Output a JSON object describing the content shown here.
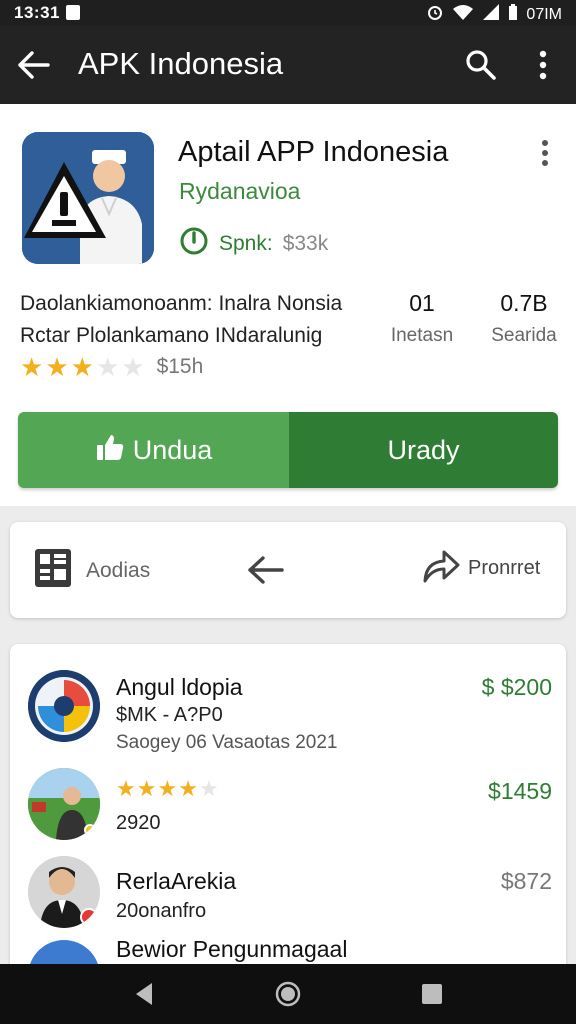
{
  "status_bar": {
    "time": "13:31",
    "notification_icon": "image-notification-icon",
    "battery_text": "07IM"
  },
  "app_bar": {
    "title": "APK Indonesia",
    "back_icon": "arrow-back-icon",
    "search_icon": "search-icon",
    "more_icon": "more-vert-icon"
  },
  "app_detail": {
    "name": "Aptail APP Indonesia",
    "developer": "Rydanavioa",
    "apk_label": "Spnk:",
    "apk_size": "$33k",
    "description_line1": "Daolankiamonoanm: Inalra Nonsia",
    "description_line2": "Rctar Plolankamano INdaralunig",
    "rating_stars": 3,
    "rating_max": 5,
    "rating_count": "$15h",
    "stat1_value": "01",
    "stat1_label": "Inetasn",
    "stat2_value": "0.7B",
    "stat2_label": "Searida",
    "install_button": "Undua",
    "secondary_button": "Urady"
  },
  "actions": {
    "left_label": "Aodias",
    "right_label": "Pronrret"
  },
  "list": [
    {
      "title": "Angul ldopia",
      "subtitle": "$MK - A?P0",
      "subtitle2": "Saogey 06 Vasaotas 2021",
      "price": "$ $200",
      "price_color": "#2e7d32"
    },
    {
      "rating_stars": 4,
      "subtitle": "2920",
      "price": "$1459",
      "price_color": "#2e7d32"
    },
    {
      "title": "RerlaArekia",
      "subtitle": "20onanfro",
      "price": "$872",
      "price_color": "#777777"
    },
    {
      "title": "Bewior Pengunmagaal"
    }
  ],
  "colors": {
    "accent_green": "#2e7d32",
    "button_light_green": "#53a653",
    "button_dark_green": "#2f7d34",
    "star_gold": "#f2b01e"
  }
}
